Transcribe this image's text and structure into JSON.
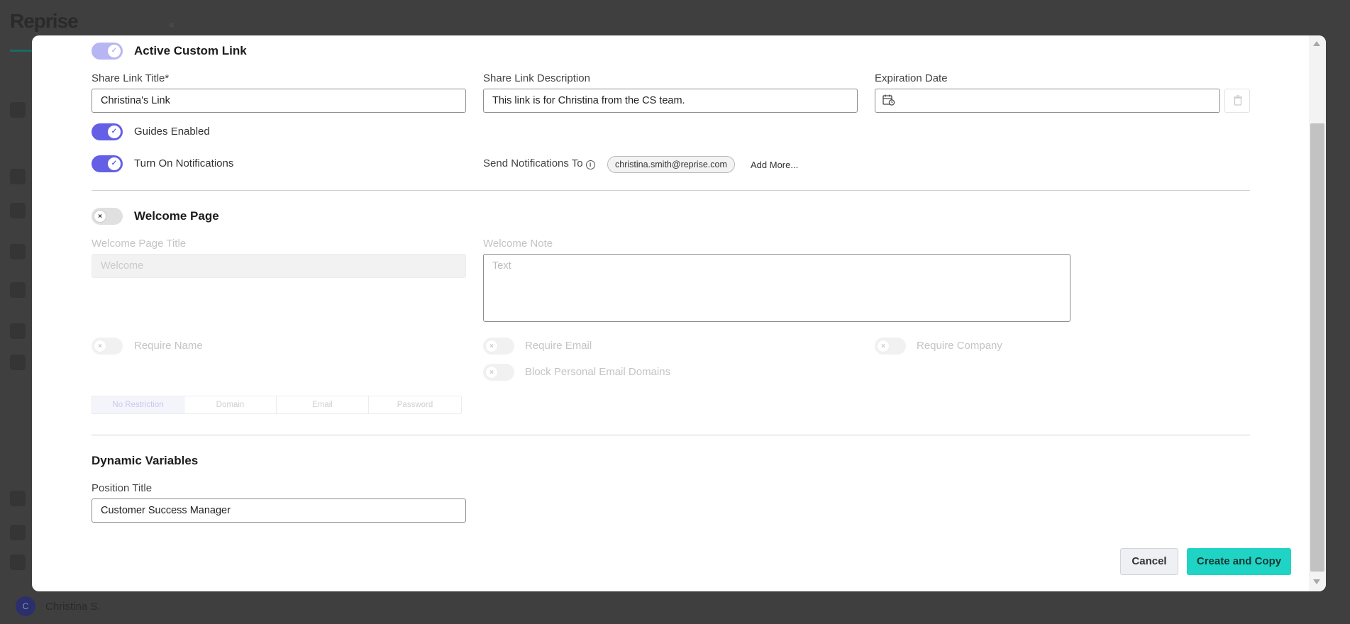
{
  "background": {
    "logo": "Reprise",
    "user_name": "Christina S.",
    "user_initial": "C"
  },
  "modal": {
    "active_custom_link": {
      "label": "Active Custom Link",
      "enabled": true
    },
    "share_link_title": {
      "label": "Share Link Title*",
      "value": "Christina's Link"
    },
    "share_link_description": {
      "label": "Share Link Description",
      "value": "This link is for Christina from the CS team."
    },
    "expiration_date": {
      "label": "Expiration Date",
      "value": ""
    },
    "guides_enabled": {
      "label": "Guides Enabled",
      "enabled": true
    },
    "turn_on_notifications": {
      "label": "Turn On Notifications",
      "enabled": true
    },
    "send_notifications_to": {
      "label": "Send Notifications To",
      "recipients": [
        "christina.smith@reprise.com"
      ],
      "add_more": "Add More..."
    },
    "welcome_page": {
      "label": "Welcome Page",
      "enabled": false,
      "title_label": "Welcome Page Title",
      "title_placeholder": "Welcome",
      "note_label": "Welcome Note",
      "note_placeholder": "Text",
      "require_name": "Require Name",
      "require_email": "Require Email",
      "require_company": "Require Company",
      "block_personal_email": "Block Personal Email Domains",
      "restriction_options": [
        "No Restriction",
        "Domain",
        "Email",
        "Password"
      ],
      "restriction_selected": "No Restriction"
    },
    "dynamic_variables": {
      "title": "Dynamic Variables",
      "position_title_label": "Position Title",
      "position_title_value": "Customer Success Manager"
    },
    "buttons": {
      "cancel": "Cancel",
      "create": "Create and Copy"
    }
  },
  "colors": {
    "toggle_on": "#6360e6",
    "primary_button": "#1fd4c4",
    "overlay": "#3f3f40"
  }
}
